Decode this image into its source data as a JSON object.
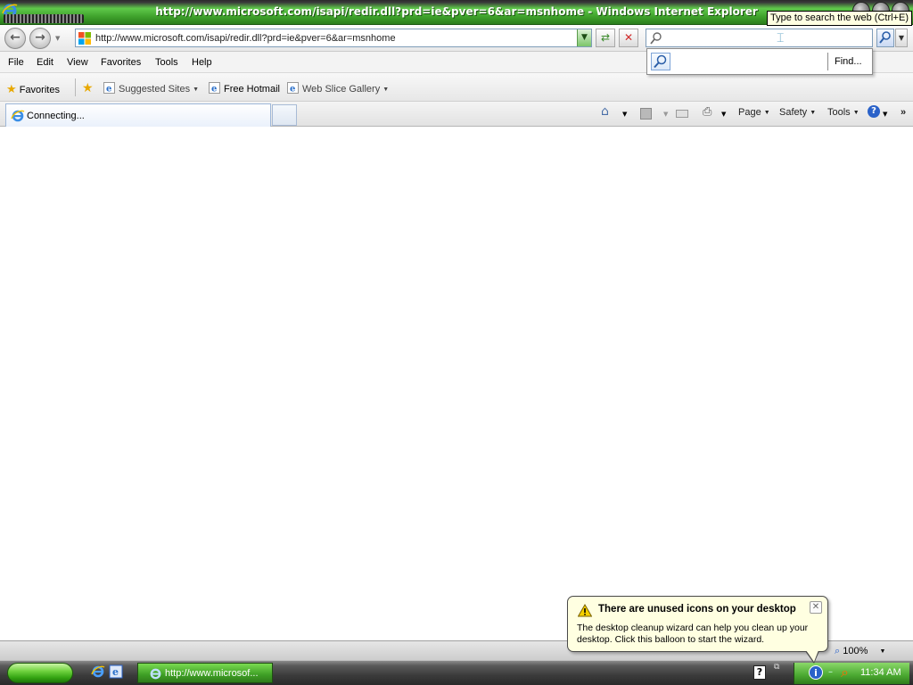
{
  "window": {
    "title": "http://www.microsoft.com/isapi/redir.dll?prd=ie&pver=6&ar=msnhome - Windows Internet Explorer"
  },
  "address": {
    "url": "http://www.microsoft.com/isapi/redir.dll?prd=ie&pver=6&ar=msnhome"
  },
  "search": {
    "value": "",
    "tooltip": "Type to search the web (Ctrl+E)",
    "dropdown_find": "Find..."
  },
  "menu": {
    "items": [
      "File",
      "Edit",
      "View",
      "Favorites",
      "Tools",
      "Help"
    ]
  },
  "favorites_bar": {
    "favorites_label": "Favorites",
    "suggested_sites": "Suggested Sites",
    "free_hotmail": "Free Hotmail",
    "web_slice_gallery": "Web Slice Gallery"
  },
  "tabs": {
    "active_label": "Connecting..."
  },
  "command_bar": {
    "page": "Page",
    "safety": "Safety",
    "tools": "Tools",
    "more": "»"
  },
  "status": {
    "zoom": "100%"
  },
  "balloon": {
    "title": "There are unused icons on your desktop",
    "body": "The desktop cleanup wizard can help you clean up your desktop. Click this balloon to start the wizard.",
    "close_glyph": "✕"
  },
  "taskbar": {
    "task_label": "http://www.microsof...",
    "clock": "11:34 AM"
  },
  "colors": {
    "theme_green": "#3ea12b",
    "tooltip_bg": "#ffffe1"
  }
}
